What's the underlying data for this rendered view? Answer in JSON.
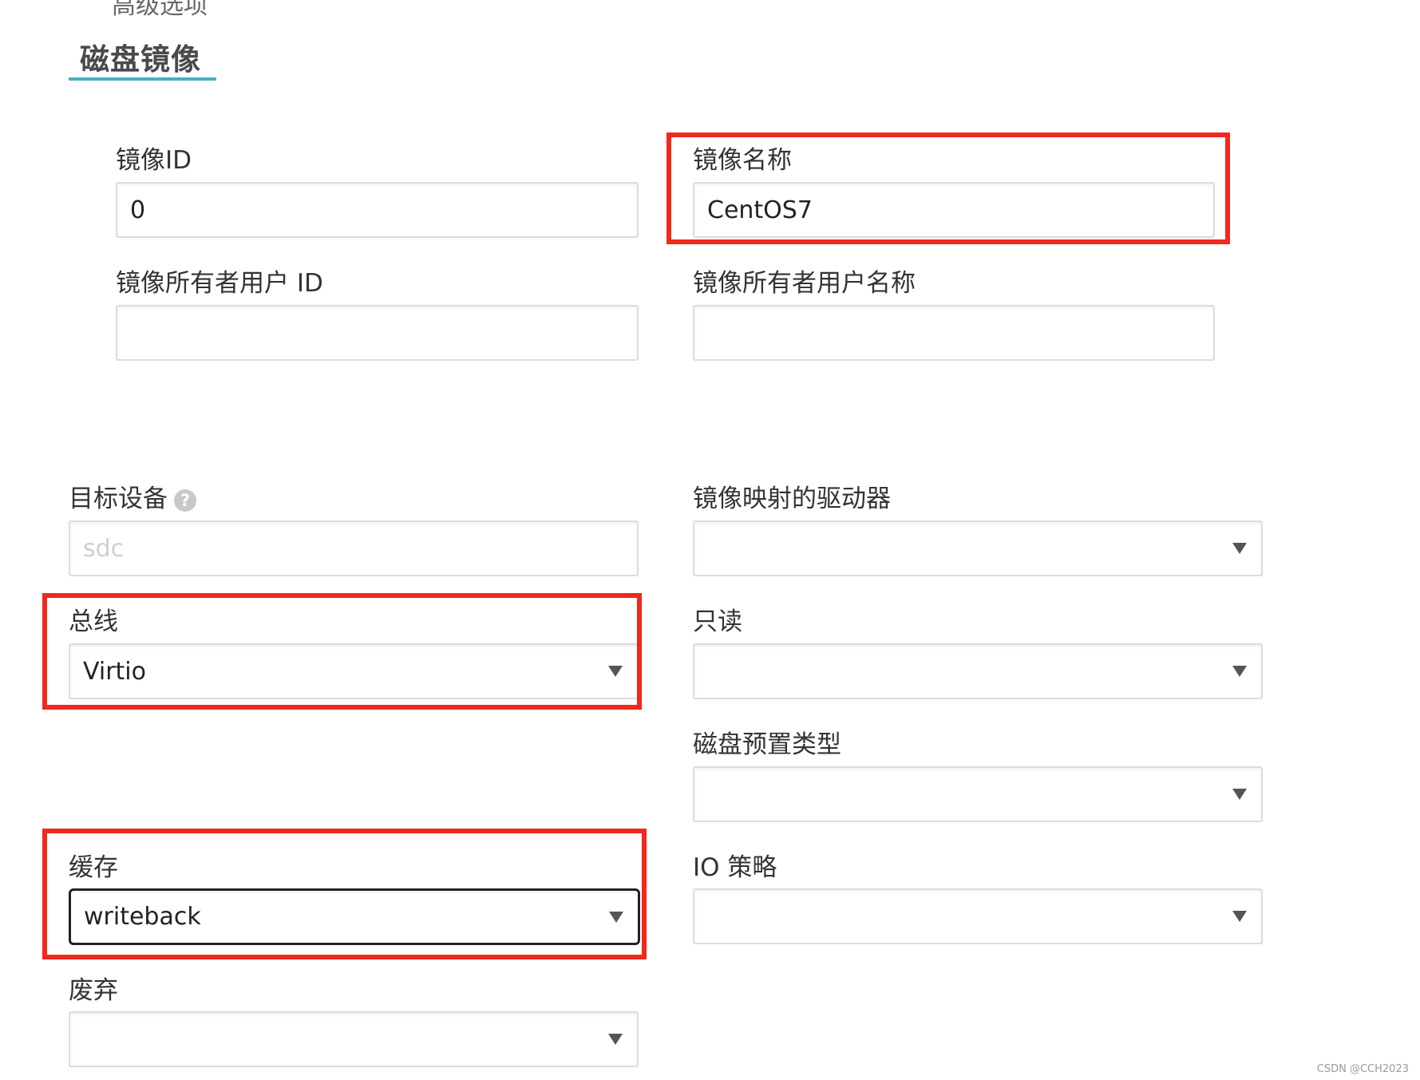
{
  "header": {
    "cut_text": "高级选项",
    "section_title": "磁盘镜像"
  },
  "fields": {
    "image_id": {
      "label": "镜像ID",
      "value": "0"
    },
    "image_name": {
      "label": "镜像名称",
      "value": "CentOS7"
    },
    "owner_user_id": {
      "label": "镜像所有者用户 ID",
      "value": ""
    },
    "owner_user_name": {
      "label": "镜像所有者用户名称",
      "value": ""
    },
    "target_device": {
      "label": "目标设备",
      "placeholder": "sdc",
      "help_icon": "?"
    },
    "driver": {
      "label": "镜像映射的驱动器",
      "value": ""
    },
    "bus": {
      "label": "总线",
      "value": "Virtio"
    },
    "readonly": {
      "label": "只读",
      "value": ""
    },
    "provisioning": {
      "label": "磁盘预置类型",
      "value": ""
    },
    "cache": {
      "label": "缓存",
      "value": "writeback"
    },
    "io_policy": {
      "label": "IO 策略",
      "value": ""
    },
    "discard": {
      "label": "废弃",
      "value": ""
    }
  },
  "highlight_color": "#f0281e",
  "accent_color": "#4aaebf",
  "watermark": "CSDN @CCH2023"
}
